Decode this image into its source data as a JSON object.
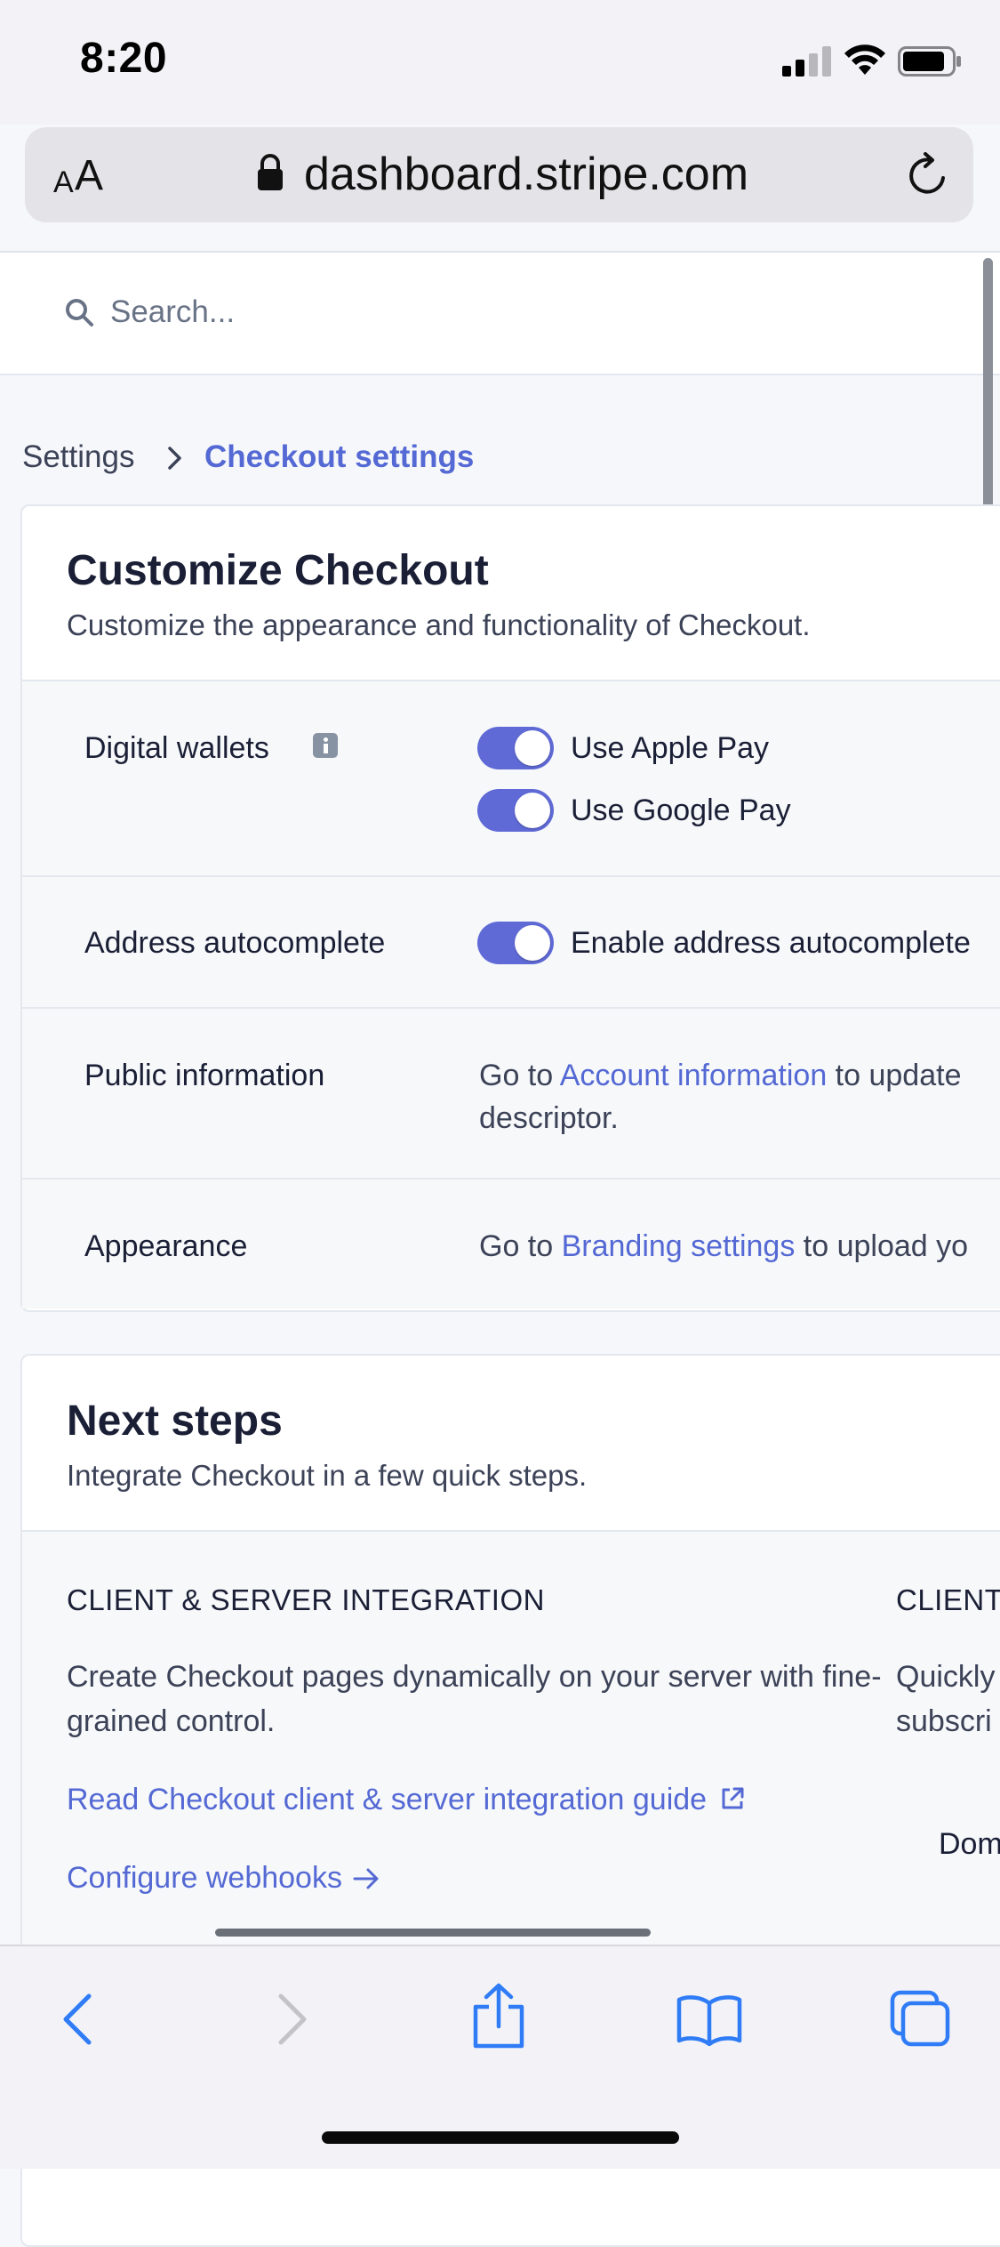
{
  "status_bar": {
    "time": "8:20"
  },
  "browser": {
    "aa_small": "A",
    "aa_big": "A",
    "url": "dashboard.stripe.com"
  },
  "search": {
    "placeholder": "Search..."
  },
  "breadcrumb": {
    "parent": "Settings",
    "current": "Checkout settings"
  },
  "customize": {
    "title": "Customize Checkout",
    "subtitle": "Customize the appearance and functionality of Checkout.",
    "digital_wallets": {
      "label": "Digital wallets",
      "apple_pay": "Use Apple Pay",
      "google_pay": "Use Google Pay"
    },
    "address_autocomplete": {
      "label": "Address autocomplete",
      "toggle_label": "Enable address autocomplete"
    },
    "public_information": {
      "label": "Public information",
      "prefix": "Go to ",
      "link": "Account information",
      "suffix": " to update",
      "line2": "descriptor."
    },
    "appearance": {
      "label": "Appearance",
      "prefix": "Go to ",
      "link": "Branding settings",
      "suffix": " to upload yo"
    }
  },
  "next_steps": {
    "title": "Next steps",
    "subtitle": "Integrate Checkout in a few quick steps.",
    "client_server": {
      "heading": "CLIENT & SERVER INTEGRATION",
      "desc_line1": "Create Checkout pages dynamically on your server with fine-",
      "desc_line2": "grained control.",
      "guide_link": "Read Checkout client & server integration guide",
      "webhooks_link": "Configure webhooks"
    },
    "client_only": {
      "heading": "CLIENT",
      "desc_line1": "Quickly",
      "desc_line2": "subscri",
      "dom": "Dom"
    }
  },
  "colors": {
    "accent": "#5469d4",
    "toggle_on": "#5f6ad6",
    "ios_blue": "#2f7cf6"
  }
}
